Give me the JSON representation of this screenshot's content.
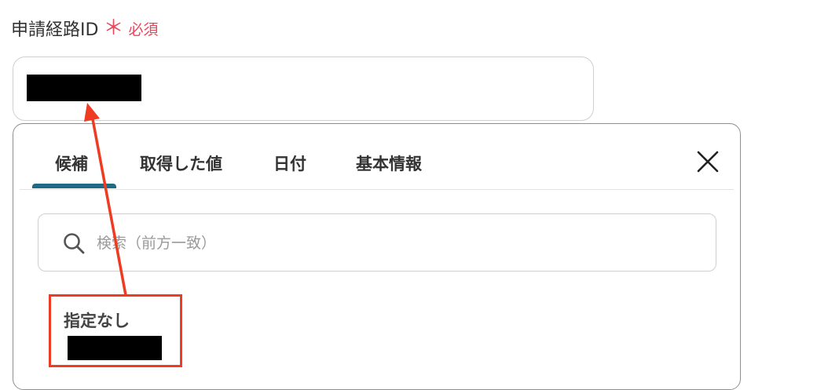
{
  "field": {
    "label": "申請経路ID",
    "asterisk": "＊",
    "required": "必須",
    "value_redacted": true
  },
  "dropdown": {
    "tabs": [
      {
        "label": "候補",
        "active": true
      },
      {
        "label": "取得した値",
        "active": false
      },
      {
        "label": "日付",
        "active": false
      },
      {
        "label": "基本情報",
        "active": false
      }
    ],
    "search_placeholder": "検索（前方一致）",
    "options": [
      {
        "label": "指定なし",
        "value_redacted": true
      }
    ]
  },
  "icons": {
    "close": "close-icon",
    "search": "search-icon"
  },
  "colors": {
    "required": "#e8475a",
    "active_tab": "#1f6a84",
    "annotation": "#ee3b22"
  }
}
